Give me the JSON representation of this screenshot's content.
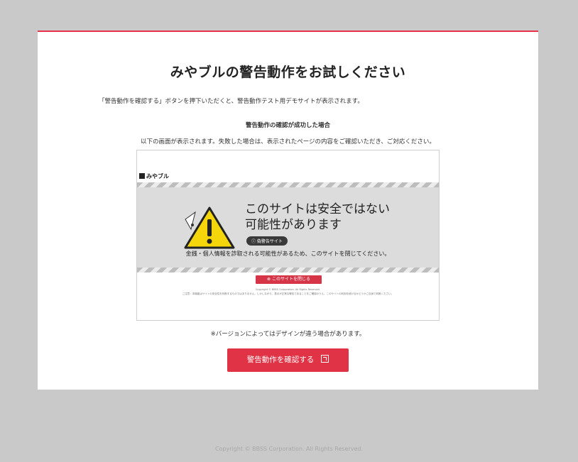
{
  "main": {
    "title": "みやブルの警告動作をお試しください",
    "intro": "「警告動作を確認する」ボタンを押下いただくと、警告動作テスト用デモサイトが表示されます。",
    "success_heading": "警告動作の確認が成功した場合",
    "success_description": "以下の画面が表示されます。失敗した場合は、表示されたページの内容をご確認いただき、ご対応ください。",
    "version_note": "※バージョンによってはデザインが違う場合があります。",
    "cta_label": "警告動作を確認する"
  },
  "preview": {
    "logo_text": "みやブル",
    "headline_line1": "このサイトは安全ではない",
    "headline_line2": "可能性があります",
    "badge": "ⓘ 偽警告サイト",
    "message": "金銭・個人情報を詐取される可能性があるため、このサイトを閉じてください。",
    "close_button": "⊗ このサイトを閉じる",
    "copyright_small": "Copyright © BBSS Corporation. All Rights Reserved.",
    "fine_print": "ご注意：本機能はサイトの安全性を判断するものではありません。しかしながら、表示が正常な警告であることをご確認のうえ、このサイトの利用を続けるかどうかご自身で判断ください。"
  },
  "footer": {
    "copyright": "Copyright © BBSS Corporation. All Rights Reserved."
  },
  "colors": {
    "accent": "#e03346",
    "background": "#c9c9c9",
    "warning_yellow": "#f5d60a"
  }
}
